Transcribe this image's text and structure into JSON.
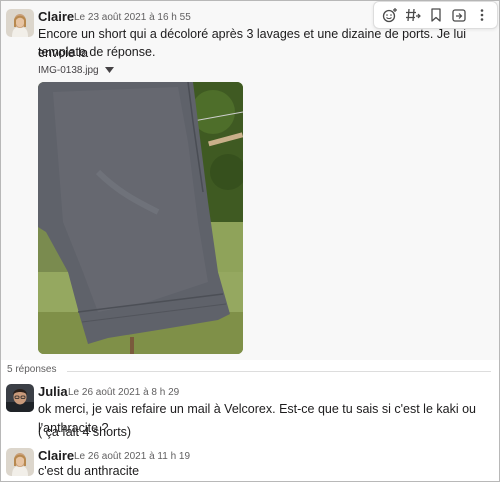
{
  "messages": [
    {
      "author": "Claire",
      "timestamp": "Le 23 août 2021 à 16 h 55",
      "lines": [
        "Encore un short qui a décoloré après 3 lavages et une dizaine de ports. Je lui envoie la",
        "template de réponse."
      ],
      "attachment": {
        "filename": "IMG-0138.jpg",
        "icon": "chevron-down-icon"
      }
    }
  ],
  "replies_count_label": "5 réponses",
  "replies": [
    {
      "author": "Julia",
      "timestamp": "Le 26 août 2021 à 8 h 29",
      "lines": [
        "ok merci, je vais refaire un mail à Velcorex. Est-ce que tu sais si c'est le kaki ou l'anthracite ?",
        "( ça fait 4 shorts)"
      ]
    },
    {
      "author": "Claire",
      "timestamp": "Le 26 août 2021 à 11 h 19",
      "lines": [
        "c'est du anthracite"
      ]
    }
  ],
  "toolbar": {
    "actions": [
      "add-reaction-icon",
      "reply-in-thread-icon",
      "bookmark-icon",
      "forward-icon",
      "more-actions-icon"
    ]
  },
  "colors": {
    "text": "#1d1c1d",
    "muted": "#616061",
    "hover_bg": "#f8f8f8",
    "border": "#dddddd"
  }
}
